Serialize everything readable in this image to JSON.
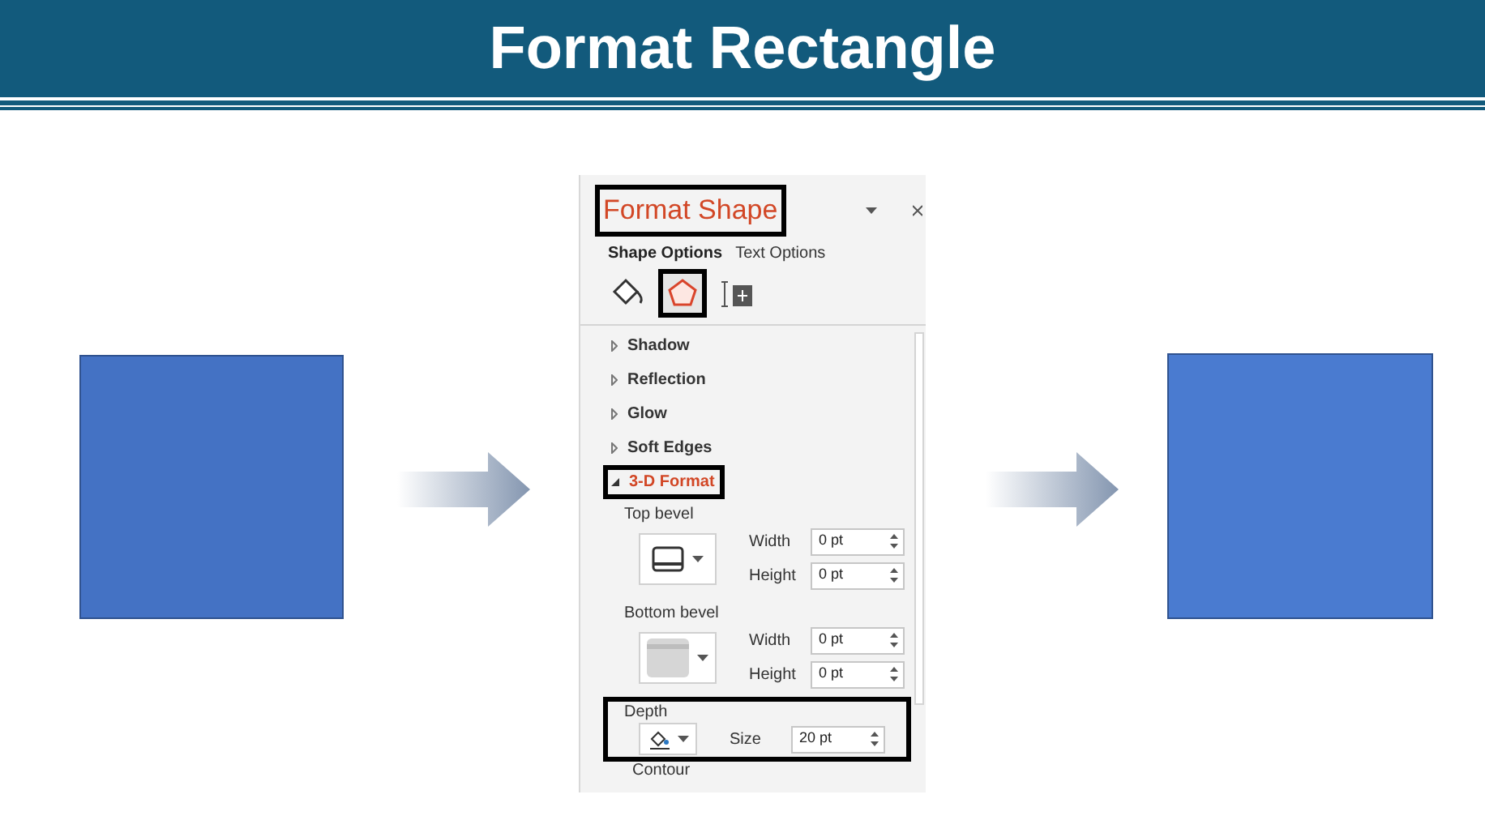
{
  "slide_title": "Format Rectangle",
  "panel": {
    "title": "Format Shape",
    "title_highlighted": true,
    "tabs": [
      {
        "label": "Shape Options",
        "selected": true
      },
      {
        "label": "Text Options",
        "selected": false
      }
    ],
    "icon_tabs": [
      {
        "kind": "fill",
        "selected": false,
        "highlighted": false
      },
      {
        "kind": "effects",
        "selected": true,
        "highlighted": true
      },
      {
        "kind": "size",
        "selected": false,
        "highlighted": false
      }
    ],
    "sections": [
      {
        "label": "Shadow",
        "expanded": false,
        "highlighted": false
      },
      {
        "label": "Reflection",
        "expanded": false,
        "highlighted": false
      },
      {
        "label": "Glow",
        "expanded": false,
        "highlighted": false
      },
      {
        "label": "Soft Edges",
        "expanded": false,
        "highlighted": false
      },
      {
        "label": "3-D Format",
        "expanded": true,
        "highlighted": true
      }
    ],
    "groups": [
      {
        "label": "Top bevel",
        "kind": "top-bevel",
        "highlighted": false,
        "fields": [
          {
            "label": "Width",
            "value": "0 pt"
          },
          {
            "label": "Height",
            "value": "0 pt"
          }
        ]
      },
      {
        "label": "Bottom bevel",
        "kind": "bottom-bevel",
        "highlighted": false,
        "fields": [
          {
            "label": "Width",
            "value": "0 pt"
          },
          {
            "label": "Height",
            "value": "0 pt"
          }
        ]
      },
      {
        "label": "Depth",
        "kind": "depth",
        "highlighted": true,
        "fields": [
          {
            "label": "Size",
            "value": "20 pt"
          }
        ]
      }
    ],
    "next_label": "Contour"
  }
}
